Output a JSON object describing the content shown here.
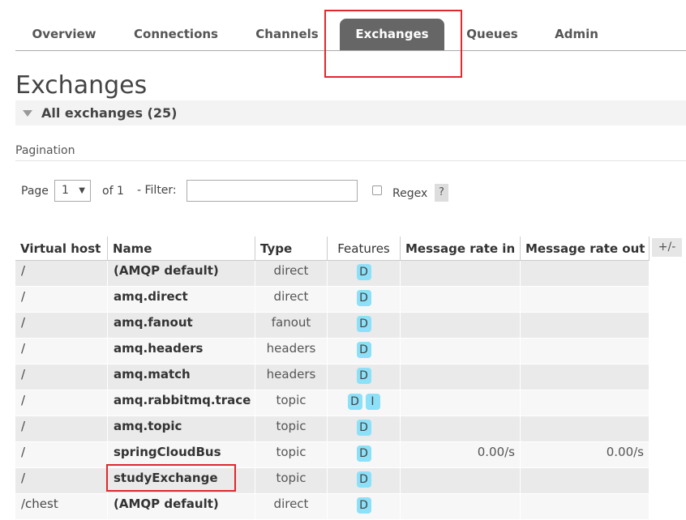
{
  "nav": {
    "tabs": [
      {
        "label": "Overview"
      },
      {
        "label": "Connections"
      },
      {
        "label": "Channels"
      },
      {
        "label": "Exchanges",
        "active": true
      },
      {
        "label": "Queues"
      },
      {
        "label": "Admin"
      }
    ]
  },
  "page": {
    "title": "Exchanges",
    "section_label": "All exchanges (25)"
  },
  "pagination": {
    "title": "Pagination",
    "page_label": "Page",
    "page_value": "1",
    "of_label": "of 1",
    "filter_label": "- Filter:",
    "filter_value": "",
    "regex_label": "Regex",
    "regex_checked": false,
    "help_label": "?"
  },
  "table": {
    "columns": [
      "Virtual host",
      "Name",
      "Type",
      "Features",
      "Message rate in",
      "Message rate out"
    ],
    "toggle_label": "+/-",
    "rows": [
      {
        "vhost": "/",
        "name": "(AMQP default)",
        "type": "direct",
        "features": [
          "D"
        ],
        "rate_in": "",
        "rate_out": ""
      },
      {
        "vhost": "/",
        "name": "amq.direct",
        "type": "direct",
        "features": [
          "D"
        ],
        "rate_in": "",
        "rate_out": ""
      },
      {
        "vhost": "/",
        "name": "amq.fanout",
        "type": "fanout",
        "features": [
          "D"
        ],
        "rate_in": "",
        "rate_out": ""
      },
      {
        "vhost": "/",
        "name": "amq.headers",
        "type": "headers",
        "features": [
          "D"
        ],
        "rate_in": "",
        "rate_out": ""
      },
      {
        "vhost": "/",
        "name": "amq.match",
        "type": "headers",
        "features": [
          "D"
        ],
        "rate_in": "",
        "rate_out": ""
      },
      {
        "vhost": "/",
        "name": "amq.rabbitmq.trace",
        "type": "topic",
        "features": [
          "D",
          "I"
        ],
        "rate_in": "",
        "rate_out": ""
      },
      {
        "vhost": "/",
        "name": "amq.topic",
        "type": "topic",
        "features": [
          "D"
        ],
        "rate_in": "",
        "rate_out": ""
      },
      {
        "vhost": "/",
        "name": "springCloudBus",
        "type": "topic",
        "features": [
          "D"
        ],
        "rate_in": "0.00/s",
        "rate_out": "0.00/s"
      },
      {
        "vhost": "/",
        "name": "studyExchange",
        "type": "topic",
        "features": [
          "D"
        ],
        "rate_in": "",
        "rate_out": ""
      },
      {
        "vhost": "/chest",
        "name": "(AMQP default)",
        "type": "direct",
        "features": [
          "D"
        ],
        "rate_in": "",
        "rate_out": ""
      }
    ]
  },
  "colors": {
    "highlight": "#e0282e",
    "active_tab": "#666666",
    "feature_badge": "#8ce0f8"
  }
}
